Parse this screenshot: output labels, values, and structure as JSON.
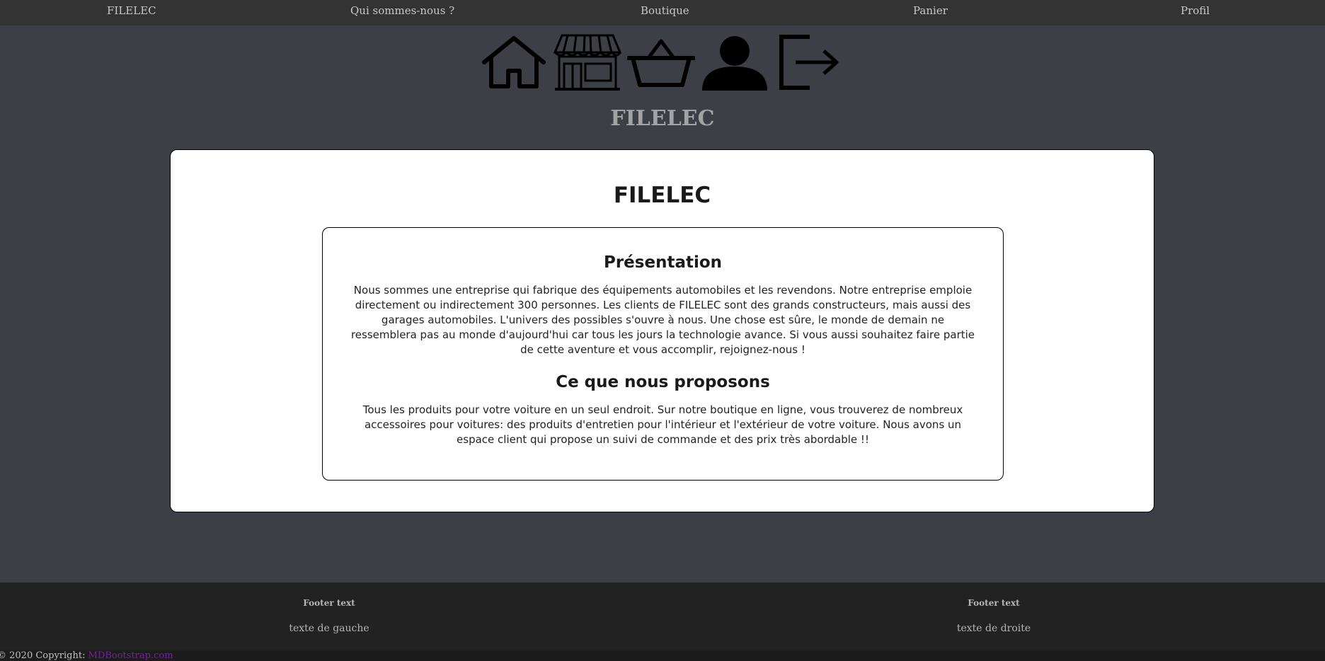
{
  "nav": {
    "items": [
      {
        "label": "FILELEC"
      },
      {
        "label": "Qui sommes-nous ?"
      },
      {
        "label": "Boutique"
      },
      {
        "label": "Panier"
      },
      {
        "label": "Profil"
      }
    ]
  },
  "icons": [
    "home-icon",
    "shop-icon",
    "basket-icon",
    "user-icon",
    "logout-icon"
  ],
  "site_title": "FILELEC",
  "card": {
    "title": "FILELEC",
    "sections": [
      {
        "heading": "Présentation",
        "text": "Nous sommes une entreprise qui fabrique des équipements automobiles et les revendons. Notre entreprise emploie directement ou indirectement 300 personnes. Les clients de FILELEC sont des grands constructeurs, mais aussi des garages automobiles. L'univers des possibles s'ouvre à nous. Une chose est sûre, le monde de demain ne ressemblera pas au monde d'aujourd'hui car tous les jours la technologie avance. Si vous aussi souhaitez faire partie de cette aventure et vous accomplir, rejoignez-nous !"
      },
      {
        "heading": "Ce que nous proposons",
        "text": "Tous les produits pour votre voiture en un seul endroit. Sur notre boutique en ligne, vous trouverez de nombreux accessoires pour voitures: des produits d'entretien pour l'intérieur et l'extérieur de votre voiture. Nous avons un espace client qui propose un suivi de commande et des prix très abordable !!"
      }
    ]
  },
  "footer": {
    "left": {
      "heading": "Footer text",
      "text": "texte de gauche"
    },
    "right": {
      "heading": "Footer text",
      "text": "texte de droite"
    }
  },
  "copyright": {
    "prefix": "© 2020 Copyright:",
    "link": "MDBootstrap.com"
  },
  "colors": {
    "page_bg": "#3c3f45",
    "nav_bg": "#333333",
    "footer_bg": "#222222",
    "link_purple": "#7b1fa2"
  }
}
